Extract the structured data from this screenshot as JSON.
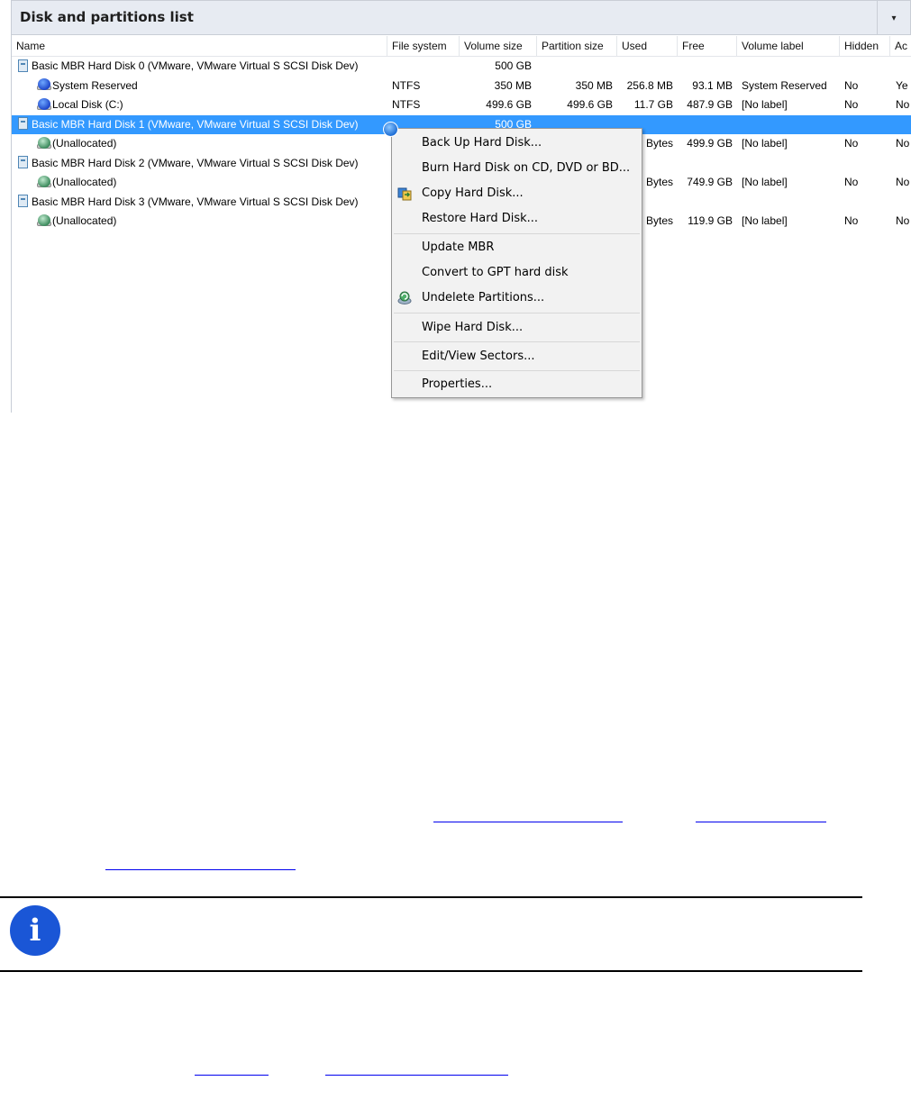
{
  "panel": {
    "title": "Disk and partitions list",
    "dropdown_glyph": "▾"
  },
  "columns": [
    "Name",
    "File system",
    "Volume size",
    "Partition size",
    "Used",
    "Free",
    "Volume label",
    "Hidden",
    "Ac"
  ],
  "rows": [
    {
      "name": "Basic MBR Hard Disk 0 (VMware, VMware Virtual S SCSI Disk Dev)",
      "icon": "hard-disk-icon",
      "fs": "",
      "vsize": "500 GB",
      "psize": "",
      "used": "",
      "free": "",
      "label": "",
      "hidden": "",
      "active": ""
    },
    {
      "name": "System Reserved",
      "icon": "partition-icon",
      "fs": "NTFS",
      "vsize": "350 MB",
      "psize": "350 MB",
      "used": "256.8 MB",
      "free": "93.1 MB",
      "label": "System Reserved",
      "hidden": "No",
      "active": "Ye"
    },
    {
      "name": "Local Disk (C:)",
      "icon": "partition-icon",
      "fs": "NTFS",
      "vsize": "499.6 GB",
      "psize": "499.6 GB",
      "used": "11.7 GB",
      "free": "487.9 GB",
      "label": "[No label]",
      "hidden": "No",
      "active": "No"
    },
    {
      "name": "Basic MBR Hard Disk 1 (VMware, VMware Virtual S SCSI Disk Dev)",
      "icon": "hard-disk-icon",
      "fs": "",
      "vsize": "500 GB",
      "psize": "",
      "used": "",
      "free": "",
      "label": "",
      "hidden": "",
      "active": ""
    },
    {
      "name": "(Unallocated)",
      "icon": "unallocated-icon",
      "fs": "",
      "vsize": "",
      "psize": "",
      "used": "Bytes",
      "free": "499.9 GB",
      "label": "[No label]",
      "hidden": "No",
      "active": "No"
    },
    {
      "name": "Basic MBR Hard Disk 2 (VMware, VMware Virtual S SCSI Disk Dev)",
      "icon": "hard-disk-icon",
      "fs": "",
      "vsize": "",
      "psize": "",
      "used": "",
      "free": "",
      "label": "",
      "hidden": "",
      "active": ""
    },
    {
      "name": "(Unallocated)",
      "icon": "unallocated-icon",
      "fs": "",
      "vsize": "",
      "psize": "",
      "used": "Bytes",
      "free": "749.9 GB",
      "label": "[No label]",
      "hidden": "No",
      "active": "No"
    },
    {
      "name": "Basic MBR Hard Disk 3 (VMware, VMware Virtual S SCSI Disk Dev)",
      "icon": "hard-disk-icon",
      "fs": "",
      "vsize": "",
      "psize": "",
      "used": "",
      "free": "",
      "label": "",
      "hidden": "",
      "active": ""
    },
    {
      "name": "(Unallocated)",
      "icon": "unallocated-icon",
      "fs": "",
      "vsize": "",
      "psize": "",
      "used": "Bytes",
      "free": "119.9 GB",
      "label": "[No label]",
      "hidden": "No",
      "active": "No"
    }
  ],
  "selected_row_index": 3,
  "context_menu": {
    "items": [
      {
        "label": "Back Up Hard Disk...",
        "icon": ""
      },
      {
        "label": "Burn Hard Disk on CD, DVD or BD...",
        "icon": ""
      },
      {
        "label": "Copy Hard Disk...",
        "icon": "copy-disk-icon"
      },
      {
        "label": "Restore Hard Disk...",
        "icon": ""
      },
      {
        "label": "Update MBR",
        "icon": ""
      },
      {
        "label": "Convert to GPT hard disk",
        "icon": ""
      },
      {
        "label": "Undelete Partitions...",
        "icon": "undelete-icon"
      },
      {
        "label": "Wipe Hard Disk...",
        "icon": ""
      },
      {
        "label": "Edit/View Sectors...",
        "icon": ""
      },
      {
        "label": "Properties...",
        "icon": ""
      }
    ]
  },
  "colors": {
    "selection": "#3399ff",
    "header_bg": "#e7ebf2",
    "menu_bg": "#f2f2f2",
    "info_icon": "#1a56d6",
    "link": "#0000ee"
  },
  "info_icon_glyph": "i"
}
